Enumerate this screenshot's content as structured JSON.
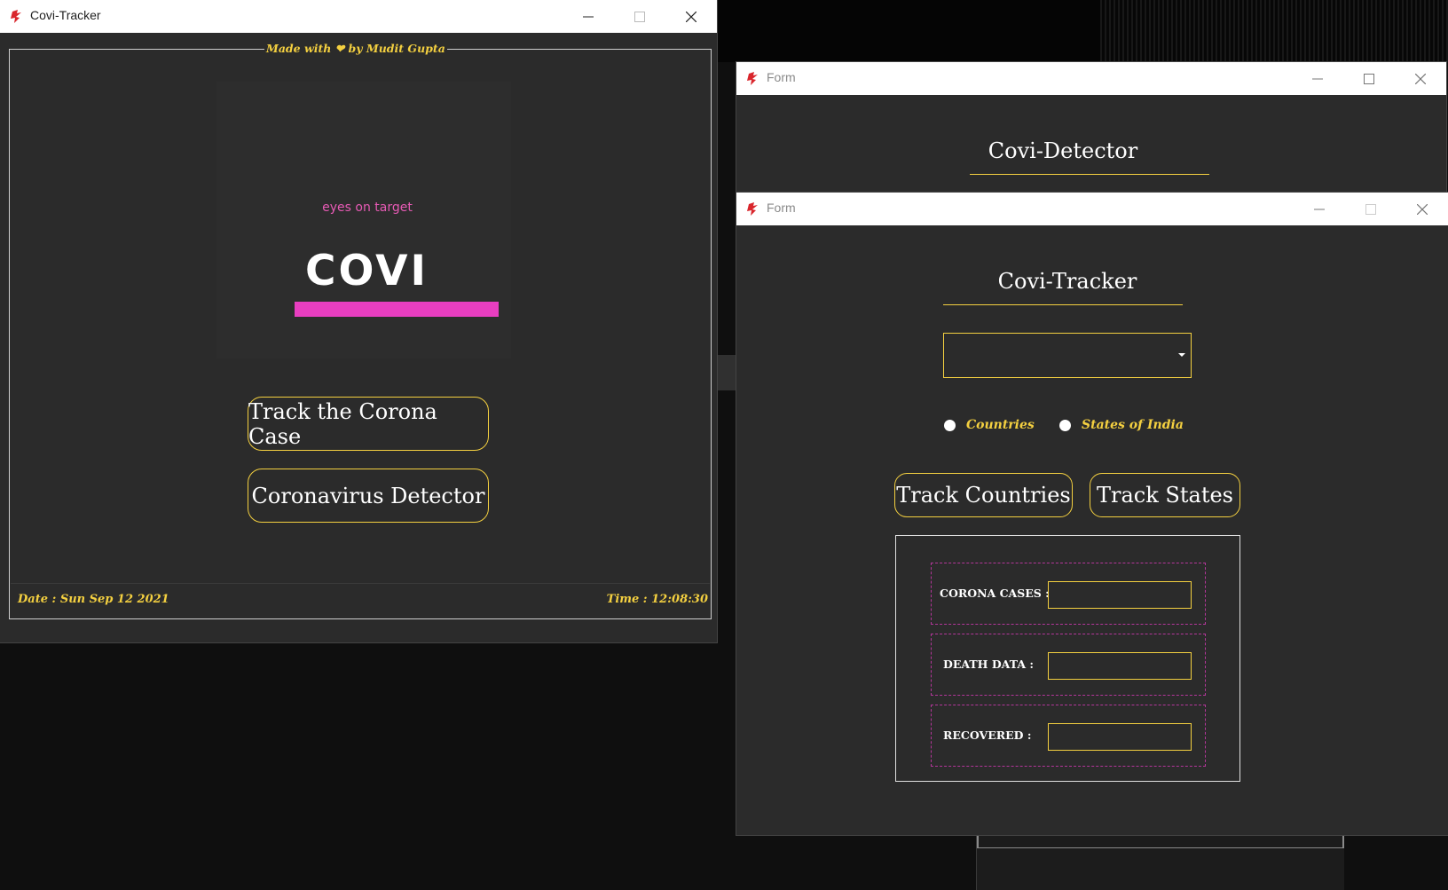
{
  "main_window": {
    "title": "Covi-Tracker",
    "credit": "Made with ❤ by Mudit Gupta",
    "logo": {
      "tagline": "eyes on target",
      "wordmark": "COVI"
    },
    "buttons": {
      "track_case": "Track the Corona Case",
      "detector": "Coronavirus Detector"
    },
    "footer": {
      "date": "Date : Sun Sep 12 2021",
      "time": "Time : 12:08:30"
    }
  },
  "detector_form": {
    "title": "Form",
    "heading": "Covi-Detector"
  },
  "tracker_form": {
    "title": "Form",
    "heading": "Covi-Tracker",
    "dropdown_value": "",
    "radios": {
      "countries": "Countries",
      "states": "States of India"
    },
    "buttons": {
      "track_countries": "Track Countries",
      "track_states": "Track States"
    },
    "results": {
      "cases_label": "CORONA CASES :",
      "death_label": "DEATH DATA :",
      "recovered_label": "RECOVERED :",
      "cases_value": "",
      "death_value": "",
      "recovered_value": ""
    }
  },
  "colors": {
    "accent": "#f4d040",
    "background": "#2b2b2b",
    "brand_pink": "#e83ec0",
    "dashed_border": "#b4369a"
  }
}
